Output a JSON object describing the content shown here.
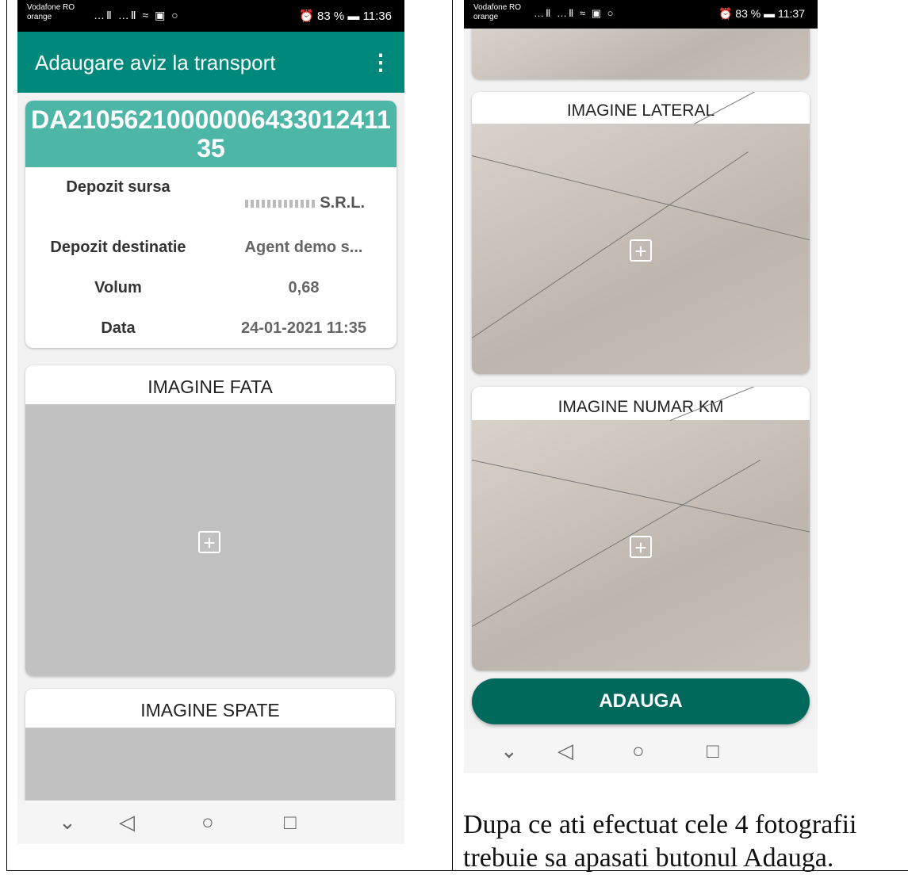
{
  "left_screen": {
    "status_bar": {
      "carrier_line1": "Vodafone RO",
      "carrier_line2": "orange",
      "signal": "…Ⅱ …Ⅱ ≈ ▣ ○",
      "battery_time": "⏰ 83 % ▬ 11:36"
    },
    "app_bar": {
      "title": "Adaugare aviz la transport",
      "menu_icon": "⋮"
    },
    "document": {
      "number": "DA21056210000006433012411 35",
      "rows": [
        {
          "label": "Depozit sursa",
          "value": "S.R.L."
        },
        {
          "label": "Depozit destinatie",
          "value": "Agent demo s..."
        },
        {
          "label": "Volum",
          "value": "0,68"
        },
        {
          "label": "Data",
          "value": "24-01-2021 11:35"
        }
      ]
    },
    "image_front": {
      "title": "IMAGINE FATA",
      "add_icon": "+"
    },
    "image_back": {
      "title": "IMAGINE SPATE"
    },
    "nav": {
      "down": "⌄",
      "back": "◁",
      "home": "○",
      "recent": "□"
    }
  },
  "right_screen": {
    "status_bar": {
      "carrier_line1": "Vodafone RO",
      "carrier_line2": "orange",
      "signal": "…Ⅱ …Ⅱ ≈ ▣ ○",
      "battery_time": "⏰ 83 % ▬ 11:37"
    },
    "image_side": {
      "title": "IMAGINE LATERAL",
      "add_icon": "+"
    },
    "image_km": {
      "title": "IMAGINE NUMAR KM",
      "add_icon": "+"
    },
    "add_button": "ADAUGA",
    "nav": {
      "down": "⌄",
      "back": "◁",
      "home": "○",
      "recent": "□"
    }
  },
  "caption": {
    "line1": "Dupa ce ati efectuat cele 4 fotografii",
    "line2": "trebuie sa apasati butonul Adauga."
  }
}
